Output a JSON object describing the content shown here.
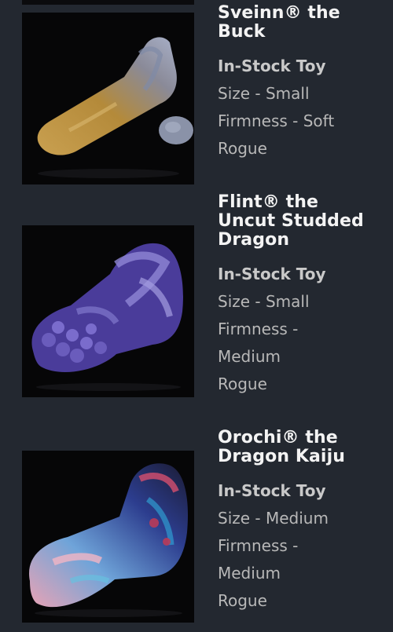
{
  "products": [
    {
      "title_line1": "Sveinn® the",
      "title_line2": "Buck",
      "stock": "In-Stock Toy",
      "size": "Size - Small",
      "firmness_line1": "Firmness - Soft",
      "style": "Rogue"
    },
    {
      "title_line1": "Flint® the",
      "title_line2": "Uncut Studded",
      "title_line3": "Dragon",
      "stock": "In-Stock Toy",
      "size": "Size - Small",
      "firmness_line1": "Firmness -",
      "firmness_line2": "Medium",
      "style": "Rogue"
    },
    {
      "title_line1": "Orochi® the",
      "title_line2": "Dragon Kaiju",
      "stock": "In-Stock Toy",
      "size": "Size - Medium",
      "firmness_line1": "Firmness -",
      "firmness_line2": "Medium",
      "style": "Rogue"
    }
  ]
}
